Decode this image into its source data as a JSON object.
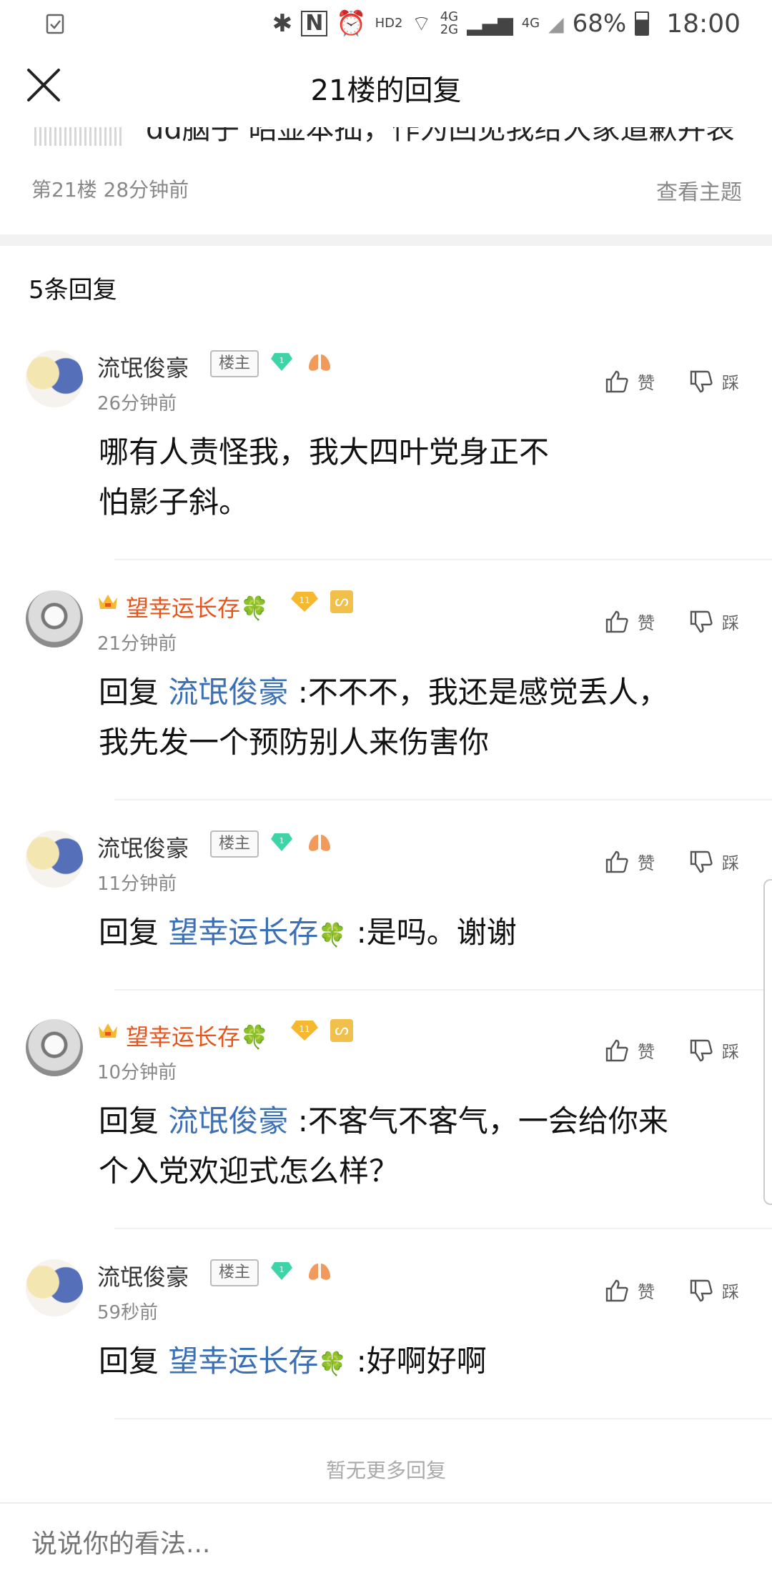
{
  "status_bar": {
    "network_hd": "HD2",
    "net_4g_top": "4G",
    "net_2g": "2G",
    "net_4g_b": "4G",
    "battery": "68%",
    "time": "18:00"
  },
  "header": {
    "title": "21楼的回复"
  },
  "original_post": {
    "text_partial": "dd脑子 昭显本拙，作为回见我给大家道歉并表",
    "floor_meta": "第21楼  28分钟前",
    "view_topic": "查看主题"
  },
  "reply_count": "5条回复",
  "labels": {
    "like": "赞",
    "dislike": "踩",
    "reply_prefix": "回复",
    "owner_badge": "楼主"
  },
  "replies": [
    {
      "user": "流氓俊豪",
      "time": "26分钟前",
      "text_line1": "哪有人责怪我，我大四叶党身正不",
      "text_line2": "怕影子斜。"
    },
    {
      "user": "望幸运长存",
      "time": "21分钟前",
      "mention": "流氓俊豪",
      "text_line1_tail": " :不不不，我还是感觉丢人，",
      "text_line2": "我先发一个预防别人来伤害你",
      "gold_level": "11"
    },
    {
      "user": "流氓俊豪",
      "time": "11分钟前",
      "mention": "望幸运长存",
      "text_tail": " :是吗。谢谢"
    },
    {
      "user": "望幸运长存",
      "time": "10分钟前",
      "mention": "流氓俊豪",
      "text_line1_tail": " :不客气不客气，一会给你来",
      "text_line2": "个入党欢迎式怎么样？",
      "gold_level": "11"
    },
    {
      "user": "流氓俊豪",
      "time": "59秒前",
      "mention": "望幸运长存",
      "text_tail": " :好啊好啊"
    }
  ],
  "footer": {
    "no_more": "暂无更多回复",
    "compose_placeholder": "说说你的看法..."
  },
  "colors": {
    "mention": "#3b6fb6",
    "gold_name": "#e8541a",
    "meta": "#888888",
    "level_gem": "#3fd3a8",
    "lung": "#f29a5c"
  },
  "icons": [
    "close-icon",
    "thumbs-up-icon",
    "thumbs-down-icon",
    "crown-icon",
    "clover-icon",
    "diamond-gem-icon",
    "lung-icon",
    "gold-gem-icon",
    "vip-badge-icon"
  ]
}
